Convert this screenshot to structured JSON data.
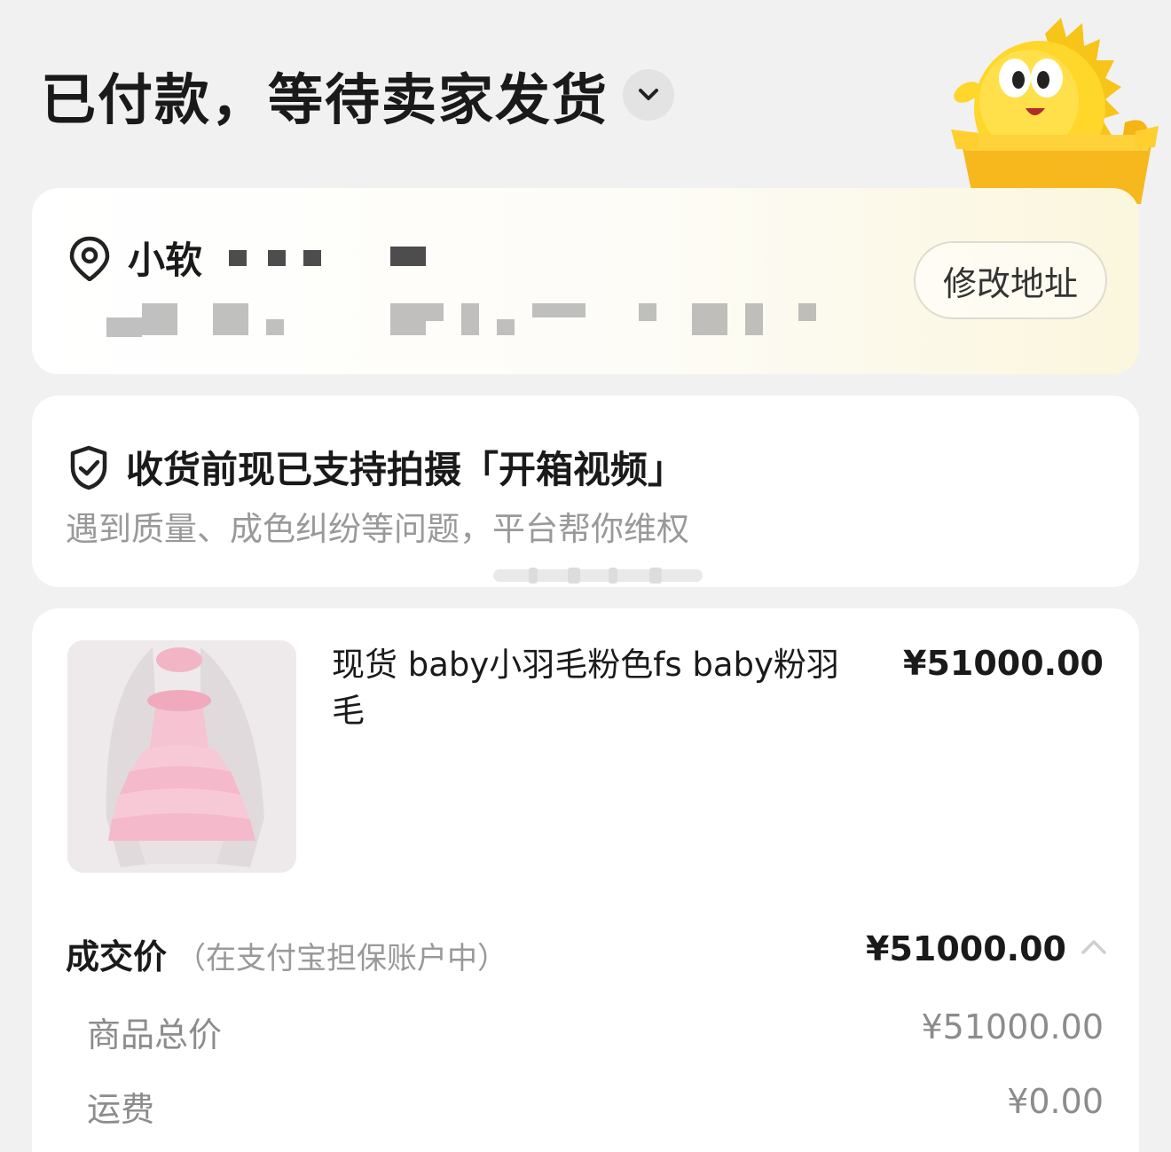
{
  "header": {
    "status_title": "已付款，等待卖家发货"
  },
  "address": {
    "name": "小软",
    "edit_button": "修改地址"
  },
  "video_support": {
    "title": "收货前现已支持拍摄「开箱视频」",
    "subtitle": "遇到质量、成色纠纷等问题，平台帮你维权"
  },
  "order": {
    "product_title": "现货 baby小羽毛粉色fs baby粉羽毛",
    "product_price": "¥51000.00",
    "deal_label": "成交价",
    "deal_note": "（在支付宝担保账户中）",
    "deal_price": "¥51000.00",
    "lines": [
      {
        "label": "商品总价",
        "value": "¥51000.00"
      },
      {
        "label": "运费",
        "value": "¥0.00"
      }
    ]
  }
}
